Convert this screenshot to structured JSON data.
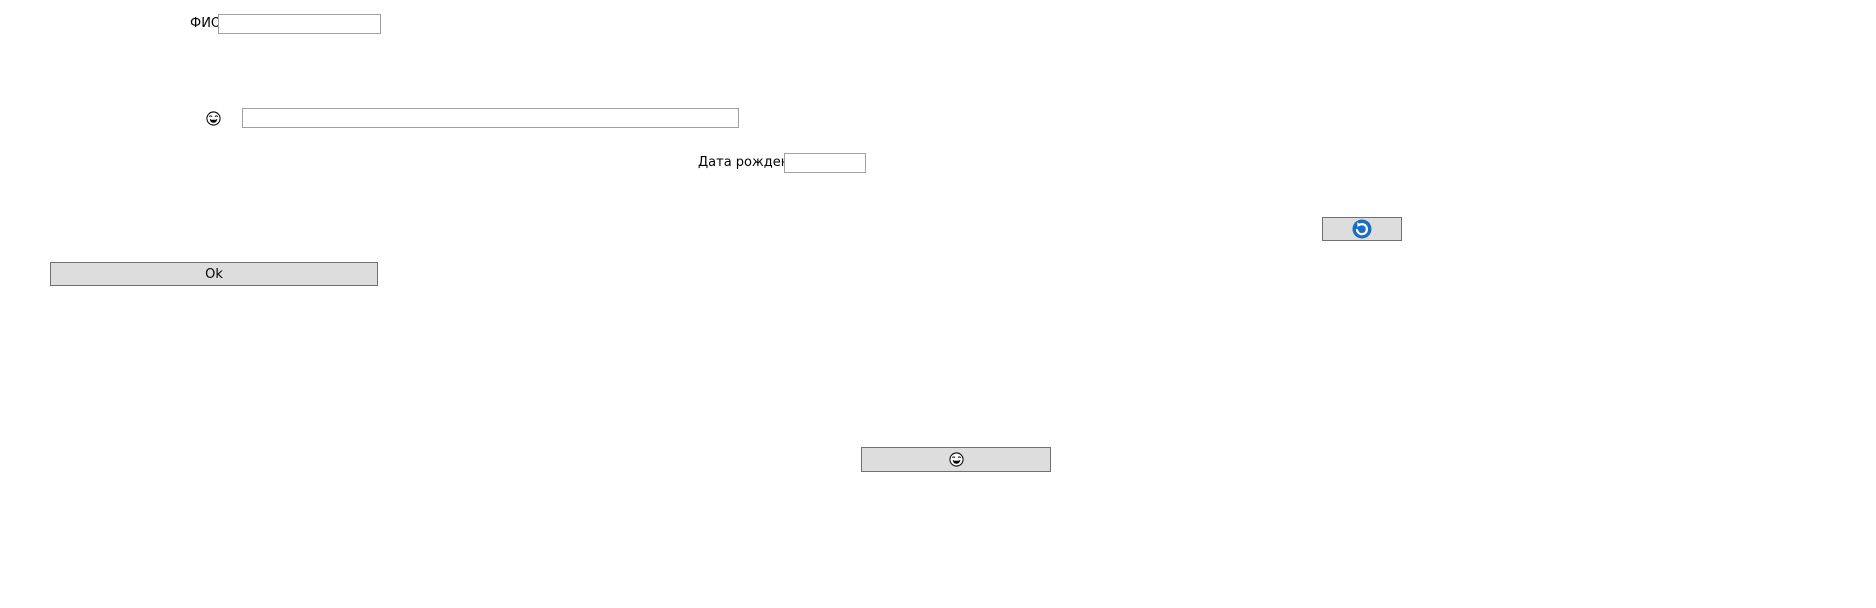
{
  "form": {
    "fio_label": "ФИО",
    "fio_value": "",
    "emoji_field_value": "",
    "birthdate_label": "Дата рождения",
    "birthdate_value": "",
    "ok_label": "Ok"
  },
  "icons": {
    "emoji_label_1": "laughing-face-icon",
    "emoji_label_2": "grinning-face-icon",
    "refresh_button_icon": "blue-refresh-icon",
    "emoji_button_icon": "laughing-face-icon"
  },
  "colors": {
    "button_bg": "#dddddd",
    "accent_blue": "#1a6fc4"
  }
}
